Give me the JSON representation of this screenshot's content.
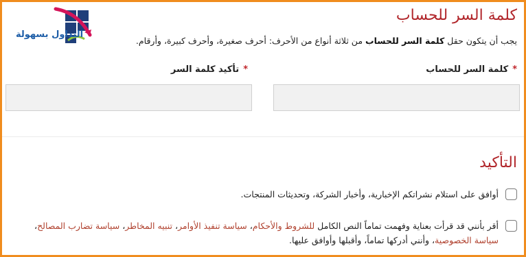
{
  "logo": {
    "text": "التداول بسهولة",
    "icon": "arrow-chart-logo",
    "colors": {
      "navy": "#1f3f7a",
      "pink": "#d4145a",
      "green": "#8dc63f",
      "blue": "#1f5fa8"
    }
  },
  "password_section": {
    "title": "كلمة السر للحساب",
    "hint_prefix": "يجب أن يتكون حقل",
    "hint_bold": "كلمة السر للحساب",
    "hint_suffix": "من ثلاثة أنواع من الأحرف: أحرف صغيرة، وأحرف كبيرة، وأرقام.",
    "password_label": "كلمة السر للحساب",
    "confirm_label": "تأكيد كلمة السر",
    "required_marker": "*",
    "password_value": "",
    "confirm_value": ""
  },
  "confirmation_section": {
    "title": "التأكيد",
    "newsletter_text": "أوافق على استلام نشراتكم الإخبارية، وأخبار الشركة، وتحديثات المنتجات.",
    "newsletter_checked": false,
    "terms_intro": "أقر بأنني قد قرأت بعناية وفهمت تماماً النص الكامل",
    "terms_link_terms": "للشروط والأحكام",
    "terms_link_execution": "سياسة تنفيذ الأوامر",
    "terms_link_risk": "تنبيه المخاطر",
    "terms_link_conflict": "سياسة تضارب المصالح",
    "terms_link_privacy": "سياسة الخصوصية",
    "terms_outro": "وأنني أدركها تماماً، وأقبلها وأوافق عليها.",
    "terms_checked": false
  },
  "colors": {
    "frame_border": "#f08c1e",
    "title": "#b1262b",
    "required": "#c0262b",
    "link": "#b0412e",
    "input_bg": "#f1f1f1"
  }
}
